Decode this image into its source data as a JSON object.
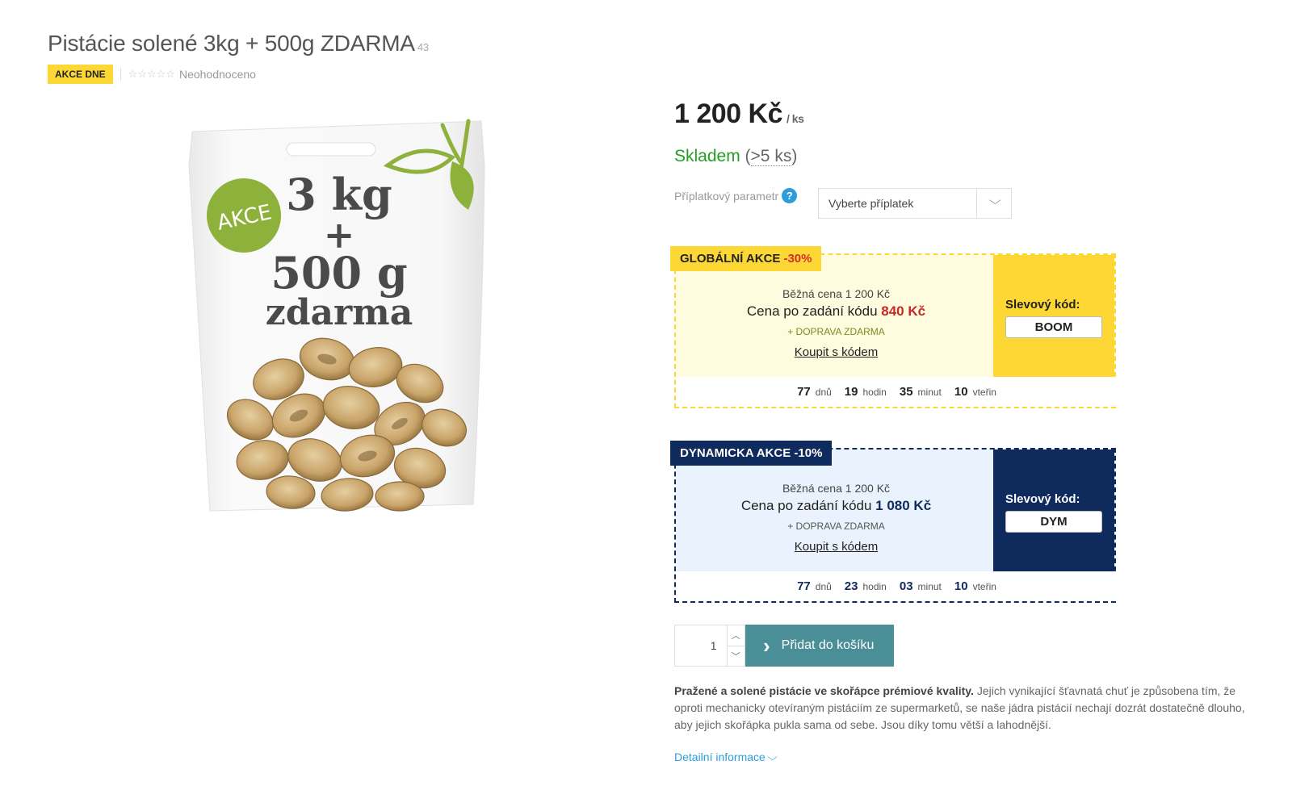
{
  "product": {
    "title": "Pistácie solené 3kg + 500g ZDARMA",
    "code": "43",
    "badge": "AKCE DNE",
    "rating_text": "Neohodnoceno",
    "stars": "☆☆☆☆☆",
    "image": {
      "sticker": "AKCE",
      "line1": "3 kg",
      "line2": "+",
      "line3": "500 g",
      "line4": "zdarma"
    }
  },
  "price": {
    "value": "1 200 Kč",
    "unit": "/ ks"
  },
  "stock": {
    "status": "Skladem",
    "amount_open": "(",
    "amount": ">5 ks",
    "amount_close": ")"
  },
  "surcharge": {
    "label": "Příplatkový parametr",
    "help": "?",
    "placeholder": "Vyberte příplatek",
    "chevron": "⌵"
  },
  "promos": {
    "global": {
      "tag": "GLOBÁLNÍ AKCE",
      "percent": "-30%",
      "regular": "Běžná cena 1 200 Kč",
      "after_label": "Cena po zadání kódu",
      "after_price": "840 Kč",
      "shipping": "+ DOPRAVA ZDARMA",
      "buy": "Koupit s kódem",
      "code_label": "Slevový kód:",
      "code": "BOOM",
      "timer": {
        "days": "77",
        "days_u": "dnů",
        "hours": "19",
        "hours_u": "hodin",
        "minutes": "35",
        "minutes_u": "minut",
        "seconds": "10",
        "seconds_u": "vteřin"
      }
    },
    "dynamic": {
      "tag": "DYNAMICKA AKCE -10%",
      "regular": "Běžná cena 1 200 Kč",
      "after_label": "Cena po zadání kódu",
      "after_price": "1 080 Kč",
      "shipping": "+ DOPRAVA ZDARMA",
      "buy": "Koupit s kódem",
      "code_label": "Slevový kód:",
      "code": "DYM",
      "timer": {
        "days": "77",
        "days_u": "dnů",
        "hours": "23",
        "hours_u": "hodin",
        "minutes": "03",
        "minutes_u": "minut",
        "seconds": "10",
        "seconds_u": "vteřin"
      }
    }
  },
  "cart": {
    "quantity": "1",
    "button": "Přidat do košíku",
    "arrow": "›"
  },
  "description": {
    "bold": "Pražené a solené pistácie ve skořápce prémiové kvality.",
    "text": " Jejich vynikající šťavnatá chuť je způsobena tím, že oproti mechanicky otevíraným pistáciím ze supermarketů, se naše jádra pistácií nechají dozrát dostatečně dlouho, aby jejich skořápka pukla sama od sebe. Jsou díky tomu větší a lahodnější."
  },
  "detail_link": "Detailní informace",
  "colors": {
    "yellow": "#fdd835",
    "navy": "#0f2a5c",
    "teal_button": "#4a8f98",
    "stock_green": "#22a024",
    "link_blue": "#2d9cdb",
    "discount_red": "#c62828"
  }
}
